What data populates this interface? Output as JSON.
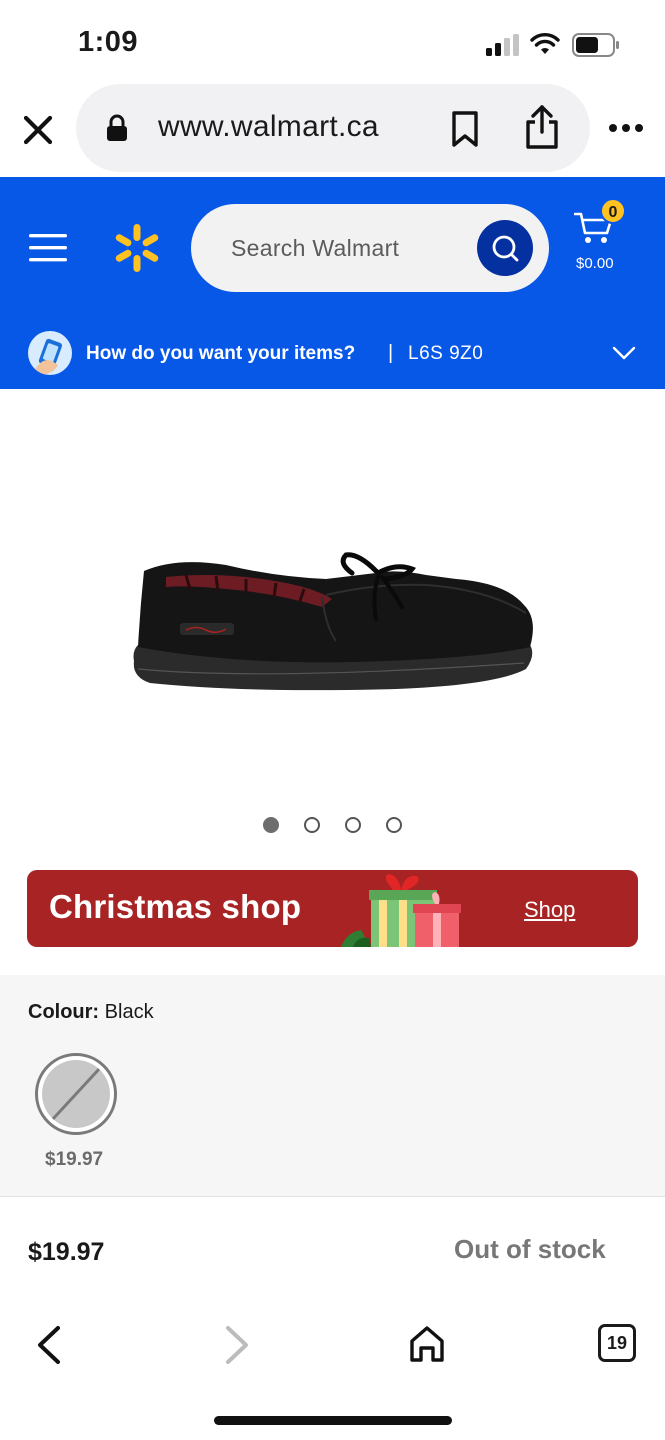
{
  "status_bar": {
    "time": "1:09"
  },
  "browser": {
    "url": "www.walmart.ca",
    "tab_count": "19"
  },
  "header": {
    "search_placeholder": "Search Walmart",
    "cart_count": "0",
    "cart_total": "$0.00",
    "delivery_question": "How do you want your items?",
    "delivery_separator": "|",
    "postal_code": "L6S 9Z0",
    "brand_color": "#0858e8",
    "spark_color": "#ffc220"
  },
  "product": {
    "image_pagination": {
      "total": 4,
      "active": 1
    },
    "colour_label": "Colour:",
    "colour_value": "Black",
    "swatch_price": "$19.97",
    "price": "$19.97",
    "stock_status": "Out of stock"
  },
  "promo_banner": {
    "title": "Christmas shop",
    "link_label": "Shop",
    "bg_color": "#a82323"
  },
  "icons": [
    "close-icon",
    "lock-icon",
    "bookmark-icon",
    "share-icon",
    "more-icon",
    "menu-icon",
    "walmart-spark-logo",
    "search-icon",
    "cart-icon",
    "delivery-icon",
    "chevron-down-icon",
    "back-icon",
    "forward-icon",
    "home-icon",
    "tabs-icon"
  ]
}
